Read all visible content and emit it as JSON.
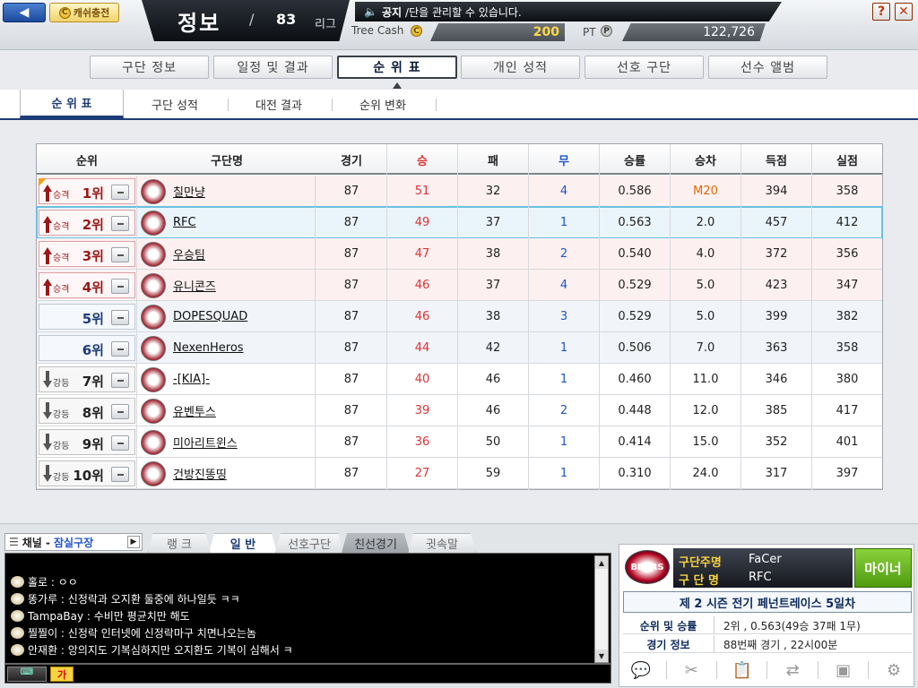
{
  "top": {
    "back_label": "◀",
    "cash_label": "캐쉬충전",
    "cash_coin": "C",
    "league_title": "정보",
    "league_slash": "/",
    "league_number": "83",
    "league_suffix": "리그",
    "notice_label": "공지",
    "notice_text": "/단을 관리할 수 있습니다.",
    "treecash_label": "Tree Cash",
    "treecash_value": "200",
    "pt_label": "PT",
    "pt_coin": "P",
    "pt_value": "122,726",
    "help_label": "?",
    "close_label": "✕"
  },
  "main_tabs": [
    "구단 정보",
    "일정 및 결과",
    "순 위 표",
    "개인 성적",
    "선호 구단",
    "선수 앨범"
  ],
  "sub_tabs": [
    "순 위 표",
    "구단 성적",
    "대전 결과",
    "순위 변화"
  ],
  "table": {
    "headers": [
      "순위",
      "구단명",
      "경기",
      "승",
      "패",
      "무",
      "승률",
      "승차",
      "득점",
      "실점"
    ],
    "rows": [
      {
        "move": "승격",
        "rank": "1위",
        "team": "칠만냥",
        "g": "87",
        "w": "51",
        "l": "32",
        "d": "4",
        "pct": "0.586",
        "gb": "M20",
        "rs": "394",
        "ra": "358"
      },
      {
        "move": "승격",
        "rank": "2위",
        "team": "RFC",
        "g": "87",
        "w": "49",
        "l": "37",
        "d": "1",
        "pct": "0.563",
        "gb": "2.0",
        "rs": "457",
        "ra": "412"
      },
      {
        "move": "승격",
        "rank": "3위",
        "team": "우승팀",
        "g": "87",
        "w": "47",
        "l": "38",
        "d": "2",
        "pct": "0.540",
        "gb": "4.0",
        "rs": "372",
        "ra": "356"
      },
      {
        "move": "승격",
        "rank": "4위",
        "team": "유니콘즈",
        "g": "87",
        "w": "46",
        "l": "37",
        "d": "4",
        "pct": "0.529",
        "gb": "5.0",
        "rs": "423",
        "ra": "347"
      },
      {
        "move": "",
        "rank": "5위",
        "team": "DOPESQUAD",
        "g": "87",
        "w": "46",
        "l": "38",
        "d": "3",
        "pct": "0.529",
        "gb": "5.0",
        "rs": "399",
        "ra": "382"
      },
      {
        "move": "",
        "rank": "6위",
        "team": "NexenHeros",
        "g": "87",
        "w": "44",
        "l": "42",
        "d": "1",
        "pct": "0.506",
        "gb": "7.0",
        "rs": "363",
        "ra": "358"
      },
      {
        "move": "강등",
        "rank": "7위",
        "team": "-[KIA]-",
        "g": "87",
        "w": "40",
        "l": "46",
        "d": "1",
        "pct": "0.460",
        "gb": "11.0",
        "rs": "346",
        "ra": "380"
      },
      {
        "move": "강등",
        "rank": "8위",
        "team": "유벤투스",
        "g": "87",
        "w": "39",
        "l": "46",
        "d": "2",
        "pct": "0.448",
        "gb": "12.0",
        "rs": "385",
        "ra": "417"
      },
      {
        "move": "강등",
        "rank": "9위",
        "team": "미아리트윈스",
        "g": "87",
        "w": "36",
        "l": "50",
        "d": "1",
        "pct": "0.414",
        "gb": "15.0",
        "rs": "352",
        "ra": "401"
      },
      {
        "move": "강등",
        "rank": "10위",
        "team": "건방진똥띵",
        "g": "87",
        "w": "27",
        "l": "59",
        "d": "1",
        "pct": "0.310",
        "gb": "24.0",
        "rs": "317",
        "ra": "397"
      }
    ]
  },
  "chat": {
    "channel_label": "채널 -",
    "channel_name": "잠실구장",
    "tabs": [
      "랭 크",
      "일 반",
      "선호구단",
      "친선경기",
      "귓속말"
    ],
    "lines": [
      "홀로 : ㅇㅇ",
      "똥가루 : 신정락과 오지환 둘중에 하나일듯 ㅋㅋ",
      "TampaBay : 수비만 평균치만 해도",
      "찔찔이 : 신정락 인터넷에 신정락마구 치면나오는놈",
      "안재환 : 앙의지도 기복심하지만 오지환도 기복이 심해서 ㅋ"
    ],
    "lang_label": "가"
  },
  "my_team": {
    "owner_label": "구단주명",
    "owner": "FaCer",
    "team_label": "구 단 명",
    "team": "RFC",
    "logo_text": "BEARS",
    "minor_label": "마이너",
    "season_title": "제 2 시즌 전기 페넌트레이스 5일차",
    "rank_label": "순위 및 승률",
    "rank_value": "2위 , 0.563(49승 37패 1무)",
    "game_label": "경기 정보",
    "game_value": "88번째 경기 , 22시00분"
  }
}
